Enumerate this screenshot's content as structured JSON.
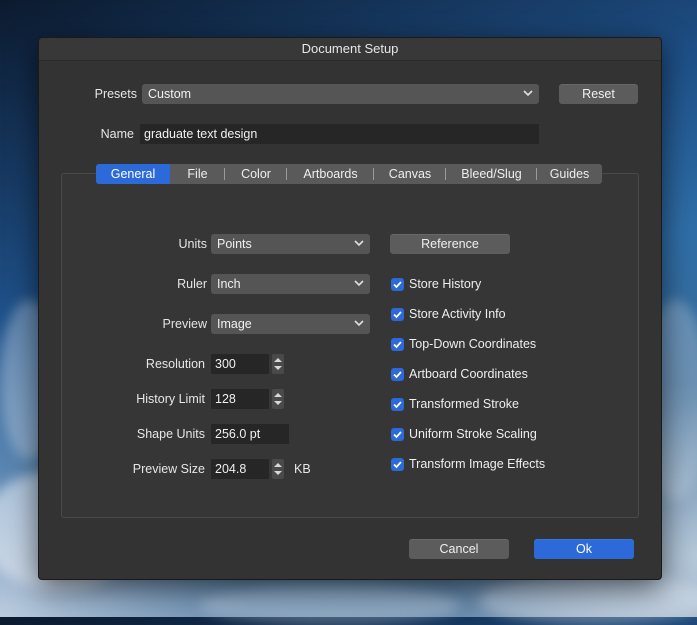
{
  "dialog": {
    "title": "Document Setup"
  },
  "presets": {
    "label": "Presets",
    "value": "Custom",
    "reset_label": "Reset"
  },
  "name": {
    "label": "Name",
    "value": "graduate text design"
  },
  "tabs": [
    {
      "label": "General",
      "active": true
    },
    {
      "label": "File"
    },
    {
      "label": "Color"
    },
    {
      "label": "Artboards"
    },
    {
      "label": "Canvas"
    },
    {
      "label": "Bleed/Slug"
    },
    {
      "label": "Guides"
    }
  ],
  "general": {
    "units": {
      "label": "Units",
      "value": "Points"
    },
    "ruler": {
      "label": "Ruler",
      "value": "Inch"
    },
    "preview": {
      "label": "Preview",
      "value": "Image"
    },
    "resolution": {
      "label": "Resolution",
      "value": "300"
    },
    "history_limit": {
      "label": "History Limit",
      "value": "128"
    },
    "shape_units": {
      "label": "Shape Units",
      "value": "256.0 pt"
    },
    "preview_size": {
      "label": "Preview Size",
      "value": "204.8",
      "unit": "KB"
    },
    "reference_label": "Reference",
    "checkboxes": [
      {
        "label": "Store History",
        "checked": true
      },
      {
        "label": "Store Activity Info",
        "checked": true
      },
      {
        "label": "Top-Down Coordinates",
        "checked": true
      },
      {
        "label": "Artboard Coordinates",
        "checked": true
      },
      {
        "label": "Transformed Stroke",
        "checked": true
      },
      {
        "label": "Uniform Stroke Scaling",
        "checked": true
      },
      {
        "label": "Transform Image Effects",
        "checked": true
      }
    ]
  },
  "footer": {
    "cancel_label": "Cancel",
    "ok_label": "Ok"
  },
  "colors": {
    "accent": "#2b6ad8",
    "dialog_bg": "#333333",
    "control_bg": "#555555"
  }
}
